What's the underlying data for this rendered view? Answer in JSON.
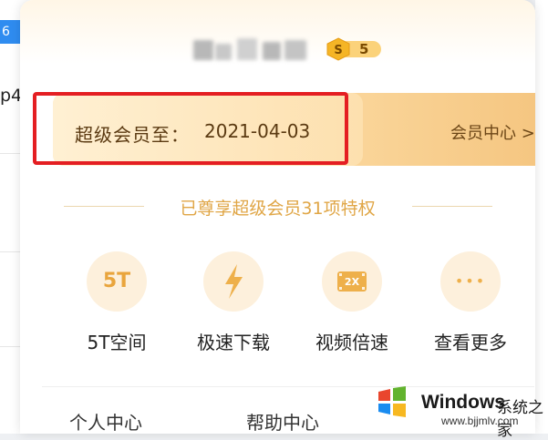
{
  "background": {
    "tab_text": "6",
    "row_text": "p4"
  },
  "badge": {
    "icon": "s-coin-badge-icon",
    "level": "5",
    "colors": {
      "gold": "#f5b526",
      "ink": "#7a4a00"
    }
  },
  "vip": {
    "label": "超级会员至：",
    "expiry": "2021-04-03",
    "member_center": "会员中心 >"
  },
  "privileges": {
    "title": "已尊享超级会员31项特权",
    "accent_color": "#e0a646"
  },
  "features": [
    {
      "icon": "5t-storage-icon",
      "glyph": "5T",
      "label": "5T空间"
    },
    {
      "icon": "lightning-speed-icon",
      "glyph": "",
      "label": "极速下载"
    },
    {
      "icon": "video-2x-icon",
      "glyph": "2X",
      "label": "视频倍速"
    },
    {
      "icon": "more-dots-icon",
      "glyph": "•••",
      "label": "查看更多"
    }
  ],
  "bottom": {
    "personal_center": "个人中心",
    "help_center": "帮助中心"
  },
  "watermark": {
    "brand": "Windows",
    "cn": "系统之家",
    "url": "www.bjjmlv.com"
  },
  "highlight_color": "#e41e22"
}
